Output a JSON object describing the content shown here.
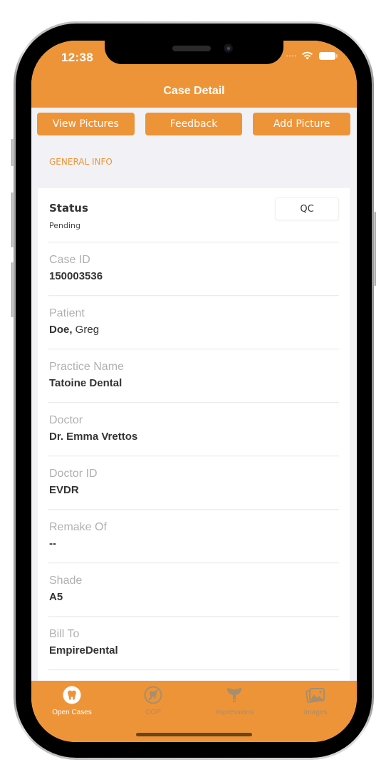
{
  "status_bar": {
    "time": "12:38",
    "wifi_icon": "wifi-icon",
    "battery_icon": "battery-icon"
  },
  "header": {
    "title": "Case Detail"
  },
  "actions": [
    {
      "label": "View Pictures"
    },
    {
      "label": "Feedback"
    },
    {
      "label": "Add Picture"
    }
  ],
  "section": {
    "title": "GENERAL INFO"
  },
  "status_row": {
    "label": "Status",
    "value": "Pending",
    "button_label": "QC"
  },
  "fields": [
    {
      "label": "Case ID",
      "value": "150003536"
    },
    {
      "label": "Patient",
      "value_bold": "Doe,",
      "value_regular": " Greg"
    },
    {
      "label": "Practice Name",
      "value": "Tatoine Dental"
    },
    {
      "label": "Doctor",
      "value": "Dr. Emma Vrettos"
    },
    {
      "label": "Doctor ID",
      "value": "EVDR"
    },
    {
      "label": "Remake Of",
      "value": "--"
    },
    {
      "label": "Shade",
      "value": "A5"
    },
    {
      "label": "Bill To",
      "value": "EmpireDental"
    }
  ],
  "tabbar": {
    "tabs": [
      {
        "label": "Open Cases",
        "icon": "tooth-icon",
        "active": true
      },
      {
        "label": "OOP",
        "icon": "no-tooth-icon",
        "active": false
      },
      {
        "label": "Impressions",
        "icon": "impression-tray-icon",
        "active": false
      },
      {
        "label": "Images",
        "icon": "images-icon",
        "active": false
      }
    ]
  },
  "colors": {
    "accent": "#EE9438",
    "background": "#F2F2F6",
    "label_gray": "#B0B0B0",
    "value_text": "#333333",
    "inactive_tab": "#A68E70"
  }
}
